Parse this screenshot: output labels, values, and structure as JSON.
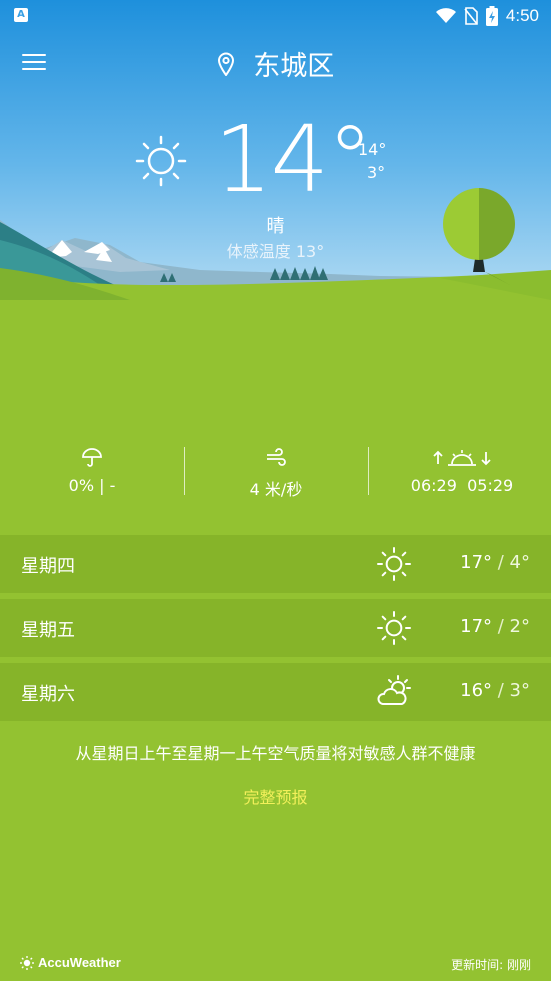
{
  "status_bar": {
    "time": "4:50",
    "app_badge": "A"
  },
  "location": {
    "name": "东城区"
  },
  "current": {
    "temp": "14°",
    "high": "14°",
    "low": "3°",
    "condition": "晴",
    "feels_like": "体感温度 13°"
  },
  "stats": {
    "precip": "0% | -",
    "wind": "4 米/秒",
    "sunrise": "06:29",
    "sunset": "05:29"
  },
  "forecast": [
    {
      "day": "星期四",
      "icon": "sun-icon",
      "high": "17°",
      "low": "4°"
    },
    {
      "day": "星期五",
      "icon": "sun-icon",
      "high": "17°",
      "low": "2°"
    },
    {
      "day": "星期六",
      "icon": "partly-cloudy-icon",
      "high": "16°",
      "low": "3°"
    }
  ],
  "air_quality_text": "从星期日上午至星期一上午空气质量将对敏感人群不健康",
  "full_forecast_label": "完整预报",
  "footer": {
    "brand": "AccuWeather",
    "updated": "更新时间: 刚刚"
  },
  "colors": {
    "sky_top": "#1e90dc",
    "sky_bottom": "#a9d6f2",
    "grass": "#93c231",
    "row_bg": "#86b429",
    "link": "#f3f05a"
  }
}
